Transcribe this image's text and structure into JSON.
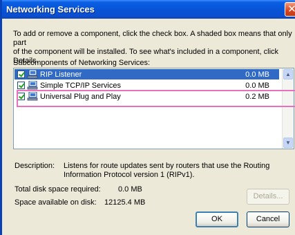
{
  "window": {
    "title": "Networking Services",
    "close_glyph": "✕"
  },
  "intro_text": "To add or remove a component, click the check box. A shaded box means that only part\nof the component will be installed. To see what's included in a component, click Details.",
  "subcomponents_label": "Subcomponents of Networking Services:",
  "components": [
    {
      "name": "RIP Listener",
      "size": "0.0 MB",
      "checked": true,
      "selected": true,
      "icon": "network-component-icon"
    },
    {
      "name": "Simple TCP/IP Services",
      "size": "0.0 MB",
      "checked": true,
      "selected": false,
      "icon": "network-component-icon"
    },
    {
      "name": "Universal Plug and Play",
      "size": "0.2 MB",
      "checked": true,
      "selected": false,
      "icon": "network-component-icon"
    }
  ],
  "description": {
    "label": "Description:",
    "text": "Listens for route updates sent by routers that use the Routing Information Protocol version 1 (RIPv1)."
  },
  "disk": {
    "required_label": "Total disk space required:",
    "required_value": "0.0 MB",
    "available_label": "Space available on disk:",
    "available_value": "12125.4 MB"
  },
  "buttons": {
    "details": "Details...",
    "ok": "OK",
    "cancel": "Cancel"
  },
  "colors": {
    "titlebar": "#0a5fe3",
    "selection": "#316ac5",
    "annotation_highlight": "#ea6fbd"
  }
}
